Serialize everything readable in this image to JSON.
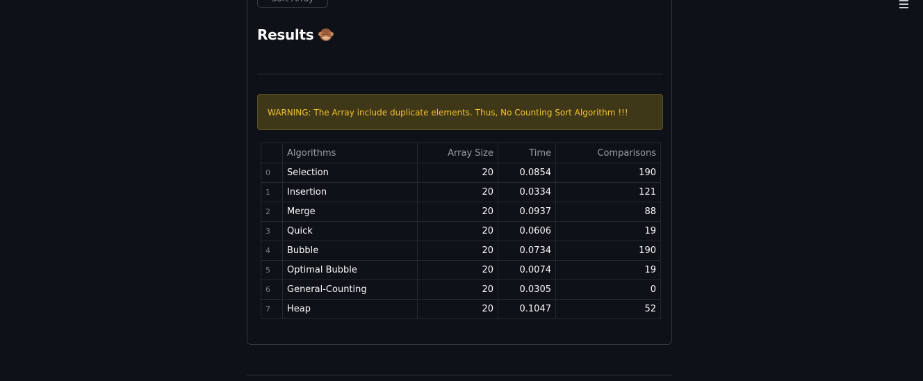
{
  "top_button": {
    "label": "Sort Array"
  },
  "results": {
    "heading": "Results",
    "icon": "see-no-evil-monkey-icon"
  },
  "warning": {
    "text": "WARNING: The Array include duplicate elements. Thus, No Counting Sort Algorithm !!!"
  },
  "table": {
    "headers": [
      "",
      "Algorithms",
      "Array Size",
      "Time",
      "Comparisons"
    ],
    "rows": [
      {
        "index": "0",
        "algorithm": "Selection",
        "size": "20",
        "time": "0.0854",
        "comparisons": "190"
      },
      {
        "index": "1",
        "algorithm": "Insertion",
        "size": "20",
        "time": "0.0334",
        "comparisons": "121"
      },
      {
        "index": "2",
        "algorithm": "Merge",
        "size": "20",
        "time": "0.0937",
        "comparisons": "88"
      },
      {
        "index": "3",
        "algorithm": "Quick",
        "size": "20",
        "time": "0.0606",
        "comparisons": "19"
      },
      {
        "index": "4",
        "algorithm": "Bubble",
        "size": "20",
        "time": "0.0734",
        "comparisons": "190"
      },
      {
        "index": "5",
        "algorithm": "Optimal Bubble",
        "size": "20",
        "time": "0.0074",
        "comparisons": "19"
      },
      {
        "index": "6",
        "algorithm": "General-Counting",
        "size": "20",
        "time": "0.0305",
        "comparisons": "0"
      },
      {
        "index": "7",
        "algorithm": "Heap",
        "size": "20",
        "time": "0.1047",
        "comparisons": "52"
      }
    ]
  },
  "colors": {
    "background": "#0e1117",
    "warning_background": "#3e3819",
    "warning_text": "#f5c12b"
  }
}
